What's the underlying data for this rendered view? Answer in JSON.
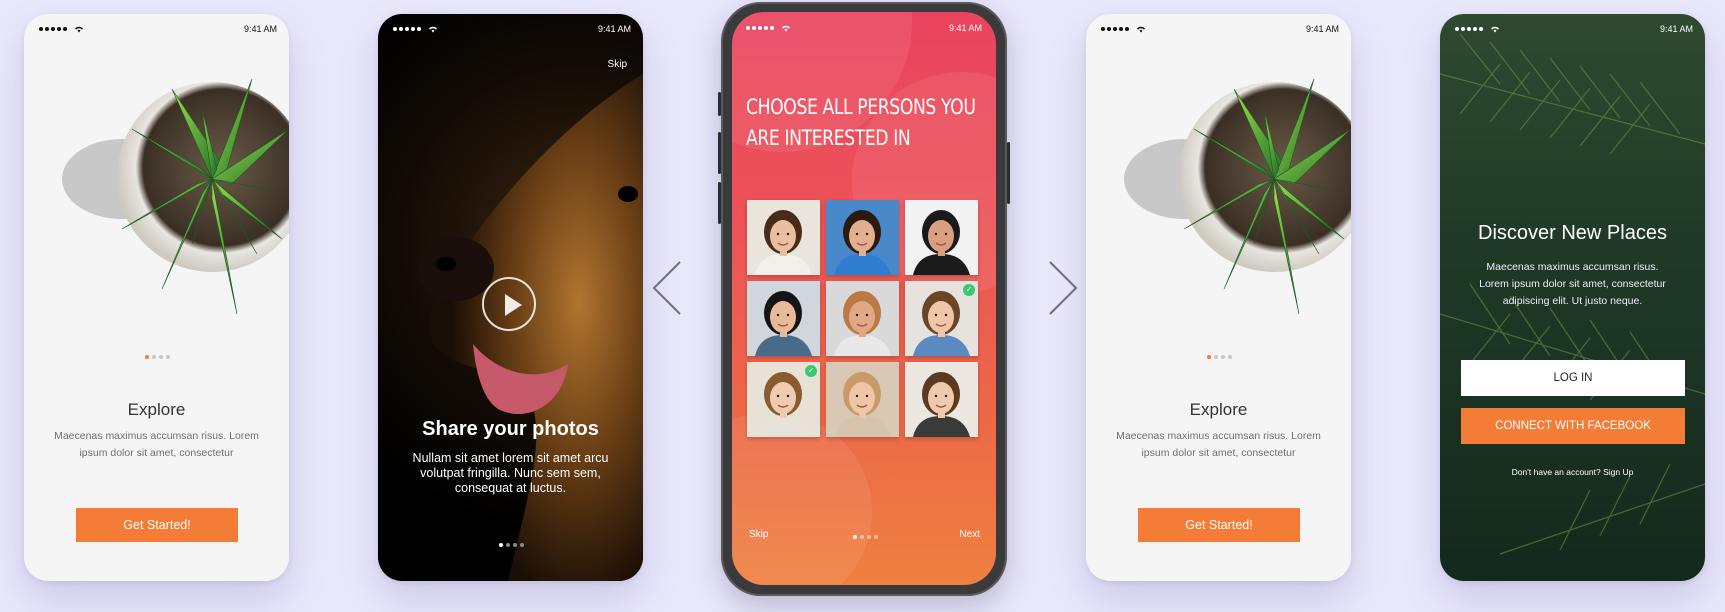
{
  "colors": {
    "background": "#e9e8fb",
    "accent_orange": "#f47c36",
    "dot_active": "#f47c36",
    "dot_inactive": "#c8c8c8",
    "check_green": "#37c871"
  },
  "status_bar": {
    "time": "9:41 AM"
  },
  "navigation": {
    "prev_icon": "chevron-left-icon",
    "next_icon": "chevron-right-icon"
  },
  "screens": {
    "explore_1": {
      "title": "Explore",
      "description": "Maecenas maximus accumsan risus. Lorem ipsum dolor sit amet, consectetur",
      "button": "Get Started!",
      "page_dots": {
        "count": 4,
        "active": 1
      }
    },
    "photos": {
      "skip": "Skip",
      "title": "Share your photos",
      "description": "Nullam sit amet lorem sit amet arcu volutpat fringilla. Nunc sem sem, consequat at luctus.",
      "play_icon": "play-icon",
      "page_dots": {
        "count": 4,
        "active": 1
      }
    },
    "choose": {
      "title": "CHOOSE ALL PERSONS YOU ARE INTERESTED IN",
      "skip": "Skip",
      "next": "Next",
      "page_dots": {
        "count": 4,
        "active": 1
      },
      "persons": [
        {
          "selected": false
        },
        {
          "selected": false
        },
        {
          "selected": false
        },
        {
          "selected": false
        },
        {
          "selected": false
        },
        {
          "selected": true
        },
        {
          "selected": true
        },
        {
          "selected": false
        },
        {
          "selected": false
        }
      ]
    },
    "explore_2": {
      "title": "Explore",
      "description": "Maecenas maximus accumsan risus. Lorem ipsum dolor sit amet, consectetur",
      "button": "Get Started!",
      "page_dots": {
        "count": 4,
        "active": 1
      }
    },
    "discover": {
      "title": "Discover New Places",
      "description": "Maecenas maximus accumsan risus. Lorem ipsum dolor sit amet, consectetur adipiscing elit. Ut justo neque.",
      "login_button": "LOG IN",
      "facebook_button": "CONNECT WITH FACEBOOK",
      "signup_text": "Don't have an account? Sign Up"
    }
  }
}
